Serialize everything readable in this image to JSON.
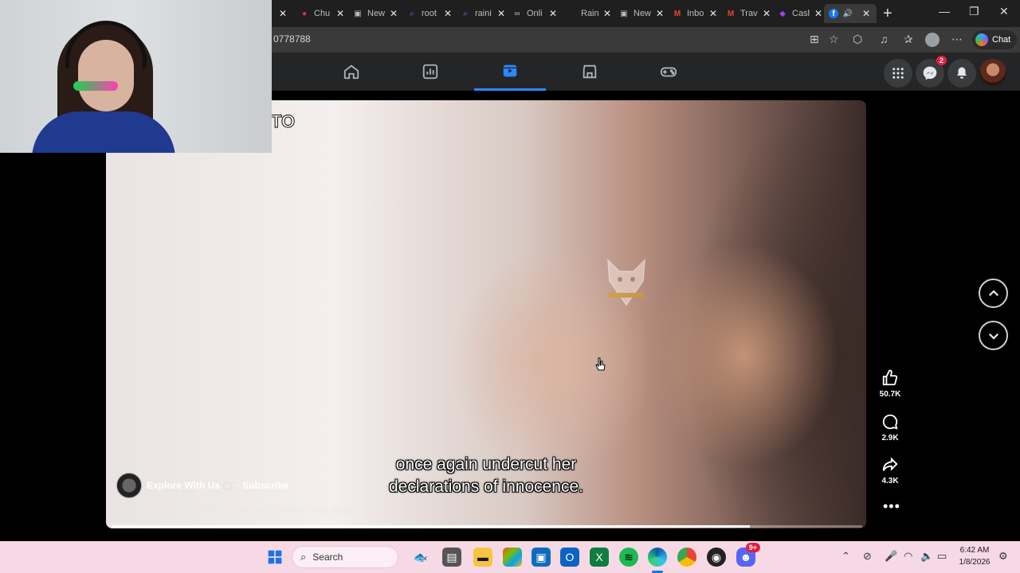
{
  "browser": {
    "tabs": [
      {
        "title": "Chu",
        "icon": "youtube-icon",
        "color": "#d9363e"
      },
      {
        "title": "New",
        "icon": "newtab-icon",
        "color": "#bdbdbd"
      },
      {
        "title": "root",
        "icon": "search-icon",
        "color": "#4c8bf5"
      },
      {
        "title": "raini",
        "icon": "search-icon",
        "color": "#4c8bf5"
      },
      {
        "title": "Onli",
        "icon": "link-icon",
        "color": "#bdbdbd"
      },
      {
        "title": "Raini",
        "icon": "page-icon",
        "color": "#bdbdbd"
      },
      {
        "title": "New",
        "icon": "newtab-icon",
        "color": "#bdbdbd"
      },
      {
        "title": "Inbo",
        "icon": "gmail-icon",
        "color": "#ea4335"
      },
      {
        "title": "Travi",
        "icon": "gmail-icon",
        "color": "#ea4335"
      },
      {
        "title": "Cash",
        "icon": "app-icon",
        "color": "#a142f4"
      },
      {
        "title": "",
        "icon": "facebook-icon",
        "color": "#1877f2",
        "active": true
      }
    ],
    "url_fragment": "0778788",
    "chat_label": "Chat"
  },
  "fb_nav": {
    "items": [
      "home-icon",
      "dashboard-icon",
      "video-icon",
      "marketplace-icon",
      "gaming-icon"
    ],
    "active_index": 2,
    "messenger_badge": "2"
  },
  "video": {
    "top_overlay_text": "TO",
    "caption_line1": "once again undercut her",
    "caption_line2": "declarations of innocence.",
    "channel_name": "Explore With Us",
    "subscribe_label": "· Subscribe",
    "description": "Mom realizes police discovered her HORRIFYING secret...",
    "progress_fraction": 0.85
  },
  "actions": {
    "likes": "50.7K",
    "comments": "2.9K",
    "shares": "4.3K"
  },
  "taskbar": {
    "search_placeholder": "Search",
    "time": "6:42 AM",
    "date": "1/8/2026",
    "discord_badge": "9+"
  },
  "colors": {
    "fb_blue": "#2d88ff",
    "taskbar_bg": "#f7d9e6",
    "badge_red": "#e41e3f"
  }
}
